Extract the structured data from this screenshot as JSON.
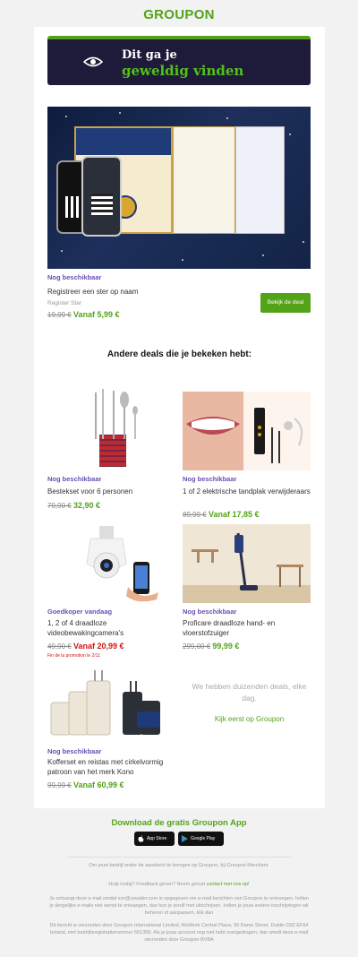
{
  "brand": {
    "logo": "GROUPON",
    "accent": "#53a318",
    "purple": "#6a4fb5",
    "red": "#d21414"
  },
  "hero": {
    "line1": "Dit ga je",
    "line2": "geweldig vinden",
    "icon": "eye-icon"
  },
  "featured": {
    "status": "Nog beschikbaar",
    "title": "Registreer een ster op naam",
    "merchant": "Register Star",
    "old_price": "19,99 €",
    "new_price": "Vanaf 5,99 €",
    "cta": "Bekijk de deal"
  },
  "section_title": "Andere deals die je bekeken hebt:",
  "deals": [
    {
      "status": "Nog beschikbaar",
      "title": "Bestekset voor 6 personen",
      "old_price": "79,90 €",
      "new_price": "32,90 €",
      "image": "cutlery-set"
    },
    {
      "status": "Nog beschikbaar",
      "title": "1 of 2 elektrische tandplak verwijderaars",
      "old_price": "89,99 €",
      "new_price": "Vanaf 17,85 €",
      "image": "dental-cleaner"
    },
    {
      "status": "Goedkoper vandaag",
      "title": "1, 2 of 4 draadloze videobewakingcamera's",
      "old_price": "49,90 €",
      "new_price": "Vanaf 20,99 €",
      "promo": "Fin de la promotion le 2/11",
      "image": "security-camera"
    },
    {
      "status": "Nog beschikbaar",
      "title": "Proficare draadloze hand- en vloerstofzuiger",
      "old_price": "299,00 €",
      "new_price": "99,99 €",
      "image": "vacuum-cleaner"
    },
    {
      "status": "Nog beschikbaar",
      "title": "Kofferset en reistas met cirkelvormig patroon van het merk Kono",
      "old_price": "99,99 €",
      "new_price": "Vanaf 60,99 €",
      "image": "luggage-set"
    }
  ],
  "more": {
    "text": "We hebben duizenden deals, elke dag.",
    "link": "Kijk eerst op Groupon"
  },
  "app": {
    "title": "Download de gratis Groupon App",
    "appstore": "App Store",
    "googleplay": "Google Play"
  },
  "footer": {
    "merchant_line": "Om jouw bedrijf onder de aandacht te brengen op Groupon, bij Groupon Merchant.",
    "help_prefix": "Hulp nodig? Feedback geven? Neem gerust",
    "help_link": "contact met ons op!",
    "subscription": "Je ontvangt deze e-mail omdat xxx@ureader.com is opgegeven om e-mail berichten van Groupon te ontvangen. Indien je dergelijke e-mails niet wenst te ontvangen, dan kun je jezelf met uitschrijven. Indien je jouw andere inschrijvingen wil beheren of aanpassen, klik dan",
    "legal": "Dit bericht is verzonden door Groupon International Limited, WeWork Central Plaza, 36 Dame Street, Dublin D02 EF64 Ierland, met bedrijfsregistratienummer 501358. Als je jouw account nog niet hebt overgedragen, dan wordt deze e-mail verzonden door Groupon BVBA"
  }
}
